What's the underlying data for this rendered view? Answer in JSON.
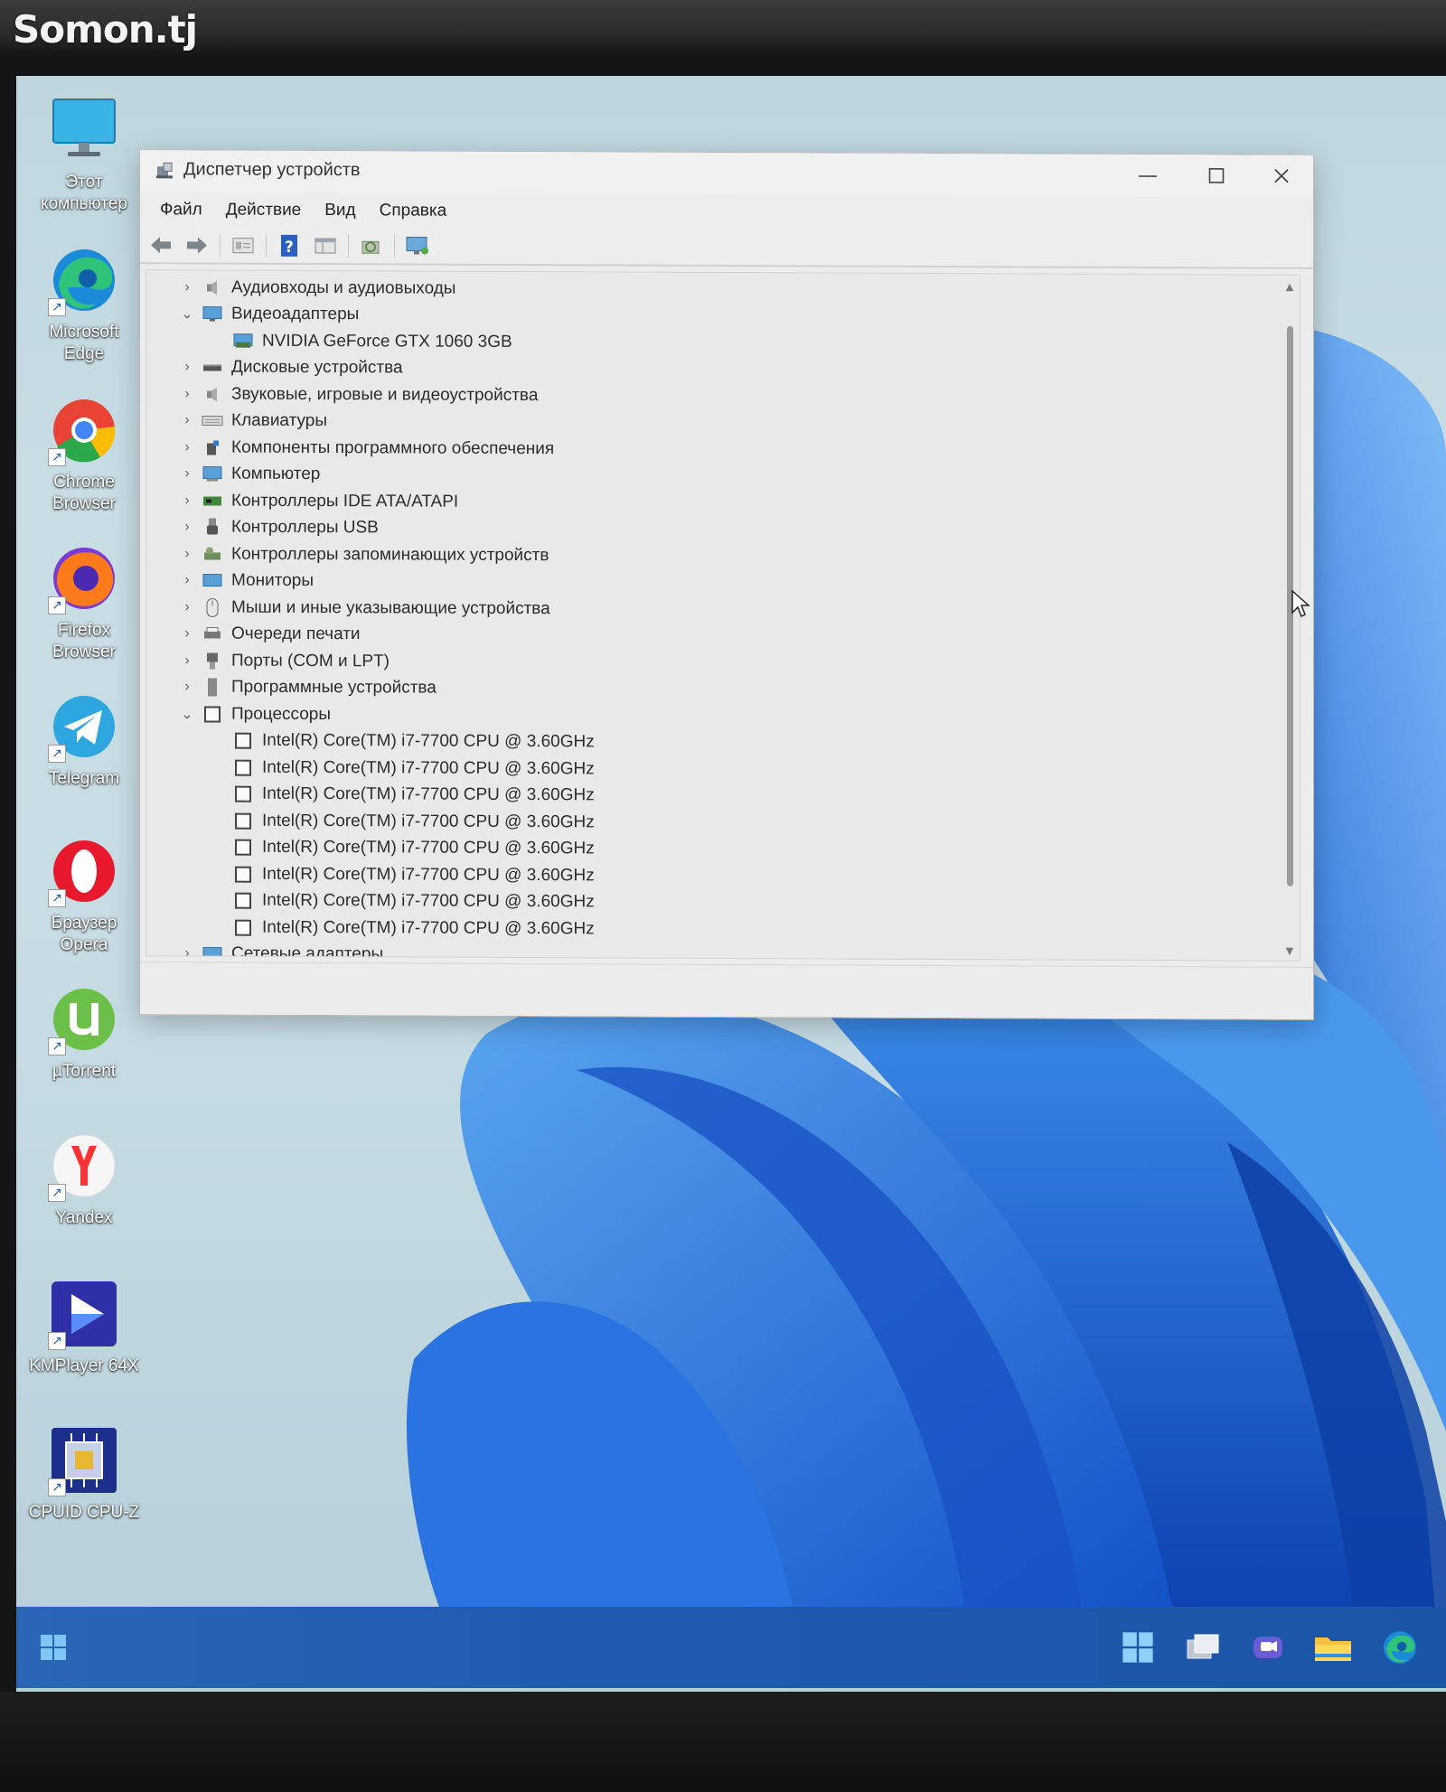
{
  "watermark": "Somon.tj",
  "desktop_icons": [
    {
      "label": "Этот\nкомпьютер",
      "icon": "monitor-icon"
    },
    {
      "label": "Microsoft\nEdge",
      "icon": "edge-icon"
    },
    {
      "label": "Chrome\nBrowser",
      "icon": "chrome-icon"
    },
    {
      "label": "Firefox\nBrowser",
      "icon": "firefox-icon"
    },
    {
      "label": "Telegram",
      "icon": "telegram-icon"
    },
    {
      "label": "Браузер\nOpera",
      "icon": "opera-icon"
    },
    {
      "label": "µTorrent",
      "icon": "utorrent-icon"
    },
    {
      "label": "Yandex",
      "icon": "yandex-icon"
    },
    {
      "label": "KMPlayer 64X",
      "icon": "kmplayer-icon"
    },
    {
      "label": "CPUID CPU-Z",
      "icon": "cpuz-icon"
    }
  ],
  "window": {
    "title": "Диспетчер устройств",
    "menu": [
      "Файл",
      "Действие",
      "Вид",
      "Справка"
    ],
    "toolbar_icons": [
      "back-arrow-icon",
      "forward-arrow-icon",
      "properties-icon",
      "help-icon",
      "view-icon",
      "scan-hardware-icon",
      "monitor-icon"
    ]
  },
  "tree": [
    {
      "label": "Аудиовходы и аудиовыходы",
      "expanded": false,
      "icon": "speaker-icon"
    },
    {
      "label": "Видеоадаптеры",
      "expanded": true,
      "icon": "display-adapter-icon",
      "children": [
        "NVIDIA GeForce GTX 1060 3GB"
      ]
    },
    {
      "label": "Дисковые устройства",
      "expanded": false,
      "icon": "disk-icon"
    },
    {
      "label": "Звуковые, игровые и видеоустройства",
      "expanded": false,
      "icon": "sound-icon"
    },
    {
      "label": "Клавиатуры",
      "expanded": false,
      "icon": "keyboard-icon"
    },
    {
      "label": "Компоненты программного обеспечения",
      "expanded": false,
      "icon": "software-component-icon"
    },
    {
      "label": "Компьютер",
      "expanded": false,
      "icon": "computer-icon"
    },
    {
      "label": "Контроллеры IDE ATA/ATAPI",
      "expanded": false,
      "icon": "ide-controller-icon"
    },
    {
      "label": "Контроллеры USB",
      "expanded": false,
      "icon": "usb-icon"
    },
    {
      "label": "Контроллеры запоминающих устройств",
      "expanded": false,
      "icon": "storage-controller-icon"
    },
    {
      "label": "Мониторы",
      "expanded": false,
      "icon": "monitor-icon"
    },
    {
      "label": "Мыши и иные указывающие устройства",
      "expanded": false,
      "icon": "mouse-icon"
    },
    {
      "label": "Очереди печати",
      "expanded": false,
      "icon": "printer-icon"
    },
    {
      "label": "Порты (COM и LPT)",
      "expanded": false,
      "icon": "port-icon"
    },
    {
      "label": "Программные устройства",
      "expanded": false,
      "icon": "software-device-icon"
    },
    {
      "label": "Процессоры",
      "expanded": true,
      "icon": "processor-icon",
      "children": [
        "Intel(R) Core(TM) i7-7700 CPU @ 3.60GHz",
        "Intel(R) Core(TM) i7-7700 CPU @ 3.60GHz",
        "Intel(R) Core(TM) i7-7700 CPU @ 3.60GHz",
        "Intel(R) Core(TM) i7-7700 CPU @ 3.60GHz",
        "Intel(R) Core(TM) i7-7700 CPU @ 3.60GHz",
        "Intel(R) Core(TM) i7-7700 CPU @ 3.60GHz",
        "Intel(R) Core(TM) i7-7700 CPU @ 3.60GHz",
        "Intel(R) Core(TM) i7-7700 CPU @ 3.60GHz"
      ]
    },
    {
      "label": "Сетевые адаптеры",
      "expanded": false,
      "icon": "network-adapter-icon"
    }
  ],
  "taskbar": {
    "icons": [
      "start-icon",
      "task-view-icon",
      "chat-icon",
      "file-explorer-icon",
      "edge-icon"
    ]
  },
  "colors": {
    "accent": "#1e5bb0",
    "wallpaper_blue": "#2f7de0"
  }
}
